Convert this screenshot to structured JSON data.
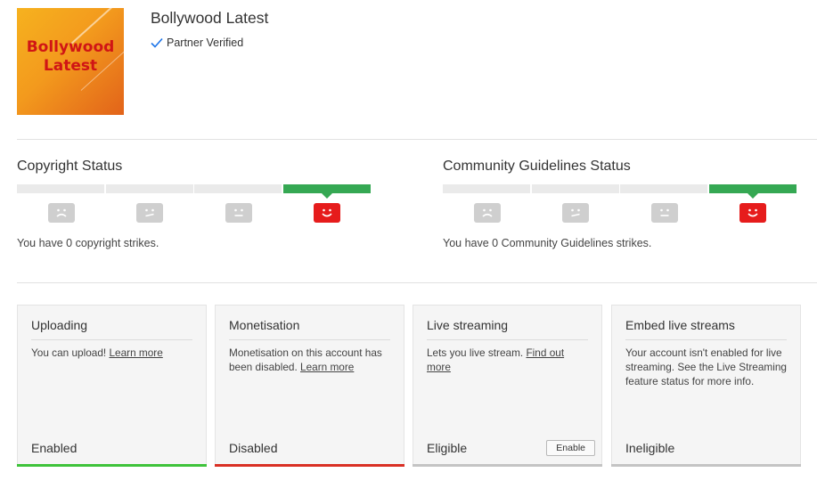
{
  "channel": {
    "name": "Bollywood Latest",
    "verified_label": "Partner Verified",
    "thumbnail_text_line1": "Bollywood",
    "thumbnail_text_line2": "Latest"
  },
  "copyright": {
    "title": "Copyright Status",
    "message": "You have 0 copyright strikes.",
    "active_level": 4
  },
  "community": {
    "title": "Community Guidelines Status",
    "message": "You have 0 Community Guidelines strikes.",
    "active_level": 4
  },
  "cards": [
    {
      "title": "Uploading",
      "desc": "You can upload! ",
      "link": "Learn more",
      "status": "Enabled",
      "color": "#3fc33b"
    },
    {
      "title": "Monetisation",
      "desc": "Monetisation on this account has been disabled. ",
      "link": "Learn more",
      "status": "Disabled",
      "color": "#d93025"
    },
    {
      "title": "Live streaming",
      "desc": "Lets you live stream. ",
      "link": "Find out more",
      "status": "Eligible",
      "button": "Enable",
      "color": "#c4c4c4"
    },
    {
      "title": "Embed live streams",
      "desc": "Your account isn't enabled for live streaming. See the Live Streaming feature status for more info.",
      "status": "Ineligible",
      "color": "#c4c4c4"
    }
  ],
  "colors": {
    "strike_active": "#35a853",
    "face_active": "#e61c1c",
    "face_inactive": "#cfcfcf"
  }
}
